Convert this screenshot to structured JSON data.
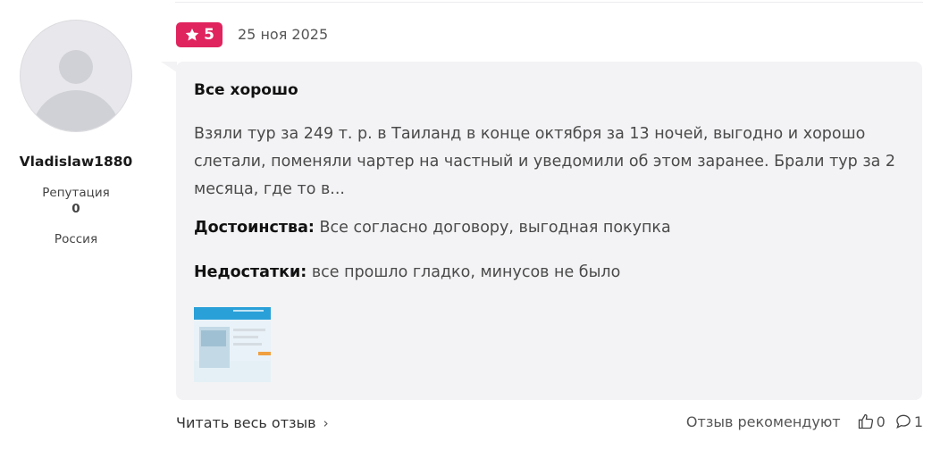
{
  "author": {
    "username": "Vladislaw1880",
    "reputation_label": "Репутация",
    "reputation_value": "0",
    "country": "Россия"
  },
  "review": {
    "rating": "5",
    "date": "25 ноя 2025",
    "title": "Все хорошо",
    "text": "Взяли тур за 249 т. р. в Таиланд в конце октября за 13 ночей, выгодно и хорошо слетали, поменяли чартер на частный и уведомили об этом заранее. Брали тур за 2 месяца, где то в...",
    "pros_label": "Достоинства:",
    "pros": "Все согласно договору, выгодная покупка",
    "cons_label": "Недостатки:",
    "cons": "все прошло гладко, минусов не было"
  },
  "footer": {
    "read_more": "Читать весь отзыв",
    "recommend_label": "Отзыв рекомендуют",
    "likes": "0",
    "comments": "1"
  },
  "icons": {
    "star": "star-icon",
    "chevron": "chevron-right-icon",
    "like": "thumbs-up-icon",
    "comment": "comment-icon"
  },
  "colors": {
    "rating_badge": "#e0245e",
    "card_bg": "#f3f3f5"
  }
}
